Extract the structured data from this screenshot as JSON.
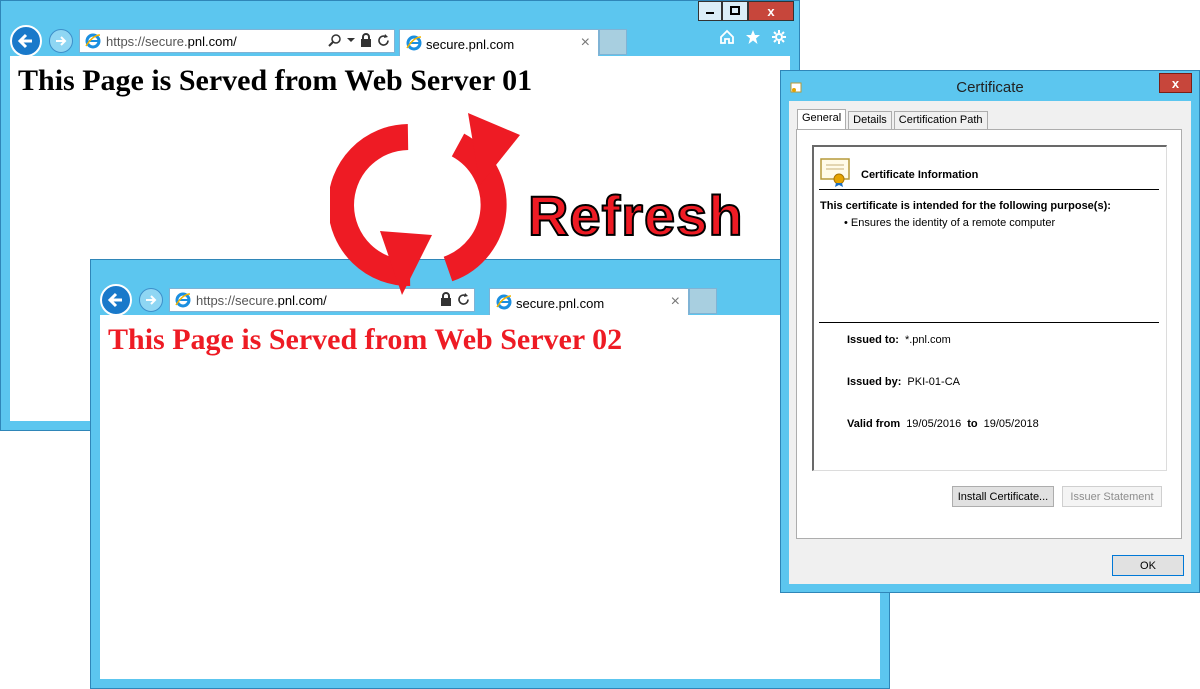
{
  "browser1": {
    "url_dim": "https://secure.",
    "url_domain": "pnl.com/",
    "tab_title": "secure.pnl.com",
    "tab_close": "×",
    "caption_close": "x",
    "page_heading": "This Page is Served from Web Server 01"
  },
  "browser2": {
    "url_dim": "https://secure.",
    "url_domain": "pnl.com/",
    "tab_title": "secure.pnl.com",
    "tab_close": "×",
    "page_heading": "This Page is Served from Web Server 02"
  },
  "refresh_label": "Refresh",
  "colors": {
    "frame": "#5cc6ef",
    "accent_red": "#ee1b24",
    "close_red": "#c7463b"
  },
  "icons": [
    "back-arrow-icon",
    "forward-arrow-icon",
    "ie-logo-icon",
    "search-icon",
    "dropdown-icon",
    "lock-icon",
    "refresh-icon",
    "home-icon",
    "favorites-star-icon",
    "settings-gear-icon",
    "certificate-icon"
  ],
  "certificate": {
    "window_title": "Certificate",
    "close": "x",
    "tabs": [
      "General",
      "Details",
      "Certification Path"
    ],
    "info_title": "Certificate Information",
    "purpose_heading": "This certificate is intended for the following purpose(s):",
    "purpose_item": "• Ensures the identity of a remote computer",
    "issued_to_label": "Issued to:",
    "issued_to": "*.pnl.com",
    "issued_by_label": "Issued by:",
    "issued_by": "PKI-01-CA",
    "valid_from_label": "Valid from",
    "valid_from": "19/05/2016",
    "to_label": "to",
    "valid_to": "19/05/2018",
    "install_button": "Install Certificate...",
    "issuer_button": "Issuer Statement",
    "ok_button": "OK"
  }
}
